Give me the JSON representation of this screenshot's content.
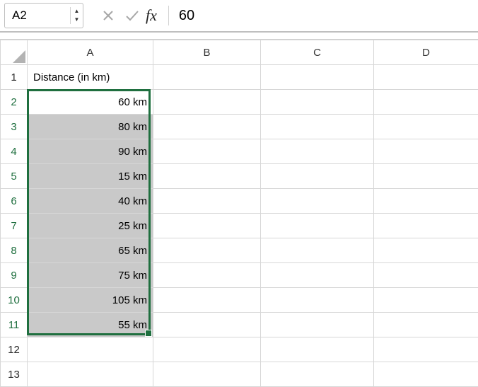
{
  "formula_bar": {
    "name_box": "A2",
    "formula_value": "60"
  },
  "columns": [
    "A",
    "B",
    "C",
    "D"
  ],
  "row_count": 13,
  "selection": {
    "active_ref": "A2",
    "range_first_row": 2,
    "range_last_row": 11,
    "range_col": "A"
  },
  "header_cell": {
    "ref": "A1",
    "text": "Distance (in km)",
    "align": "left"
  },
  "data_cells": [
    {
      "ref": "A2",
      "text": "60 km"
    },
    {
      "ref": "A3",
      "text": "80 km"
    },
    {
      "ref": "A4",
      "text": "90 km"
    },
    {
      "ref": "A5",
      "text": "15 km"
    },
    {
      "ref": "A6",
      "text": "40 km"
    },
    {
      "ref": "A7",
      "text": "25 km"
    },
    {
      "ref": "A8",
      "text": "65 km"
    },
    {
      "ref": "A9",
      "text": "75 km"
    },
    {
      "ref": "A10",
      "text": "105 km"
    },
    {
      "ref": "A11",
      "text": "55 km"
    }
  ]
}
